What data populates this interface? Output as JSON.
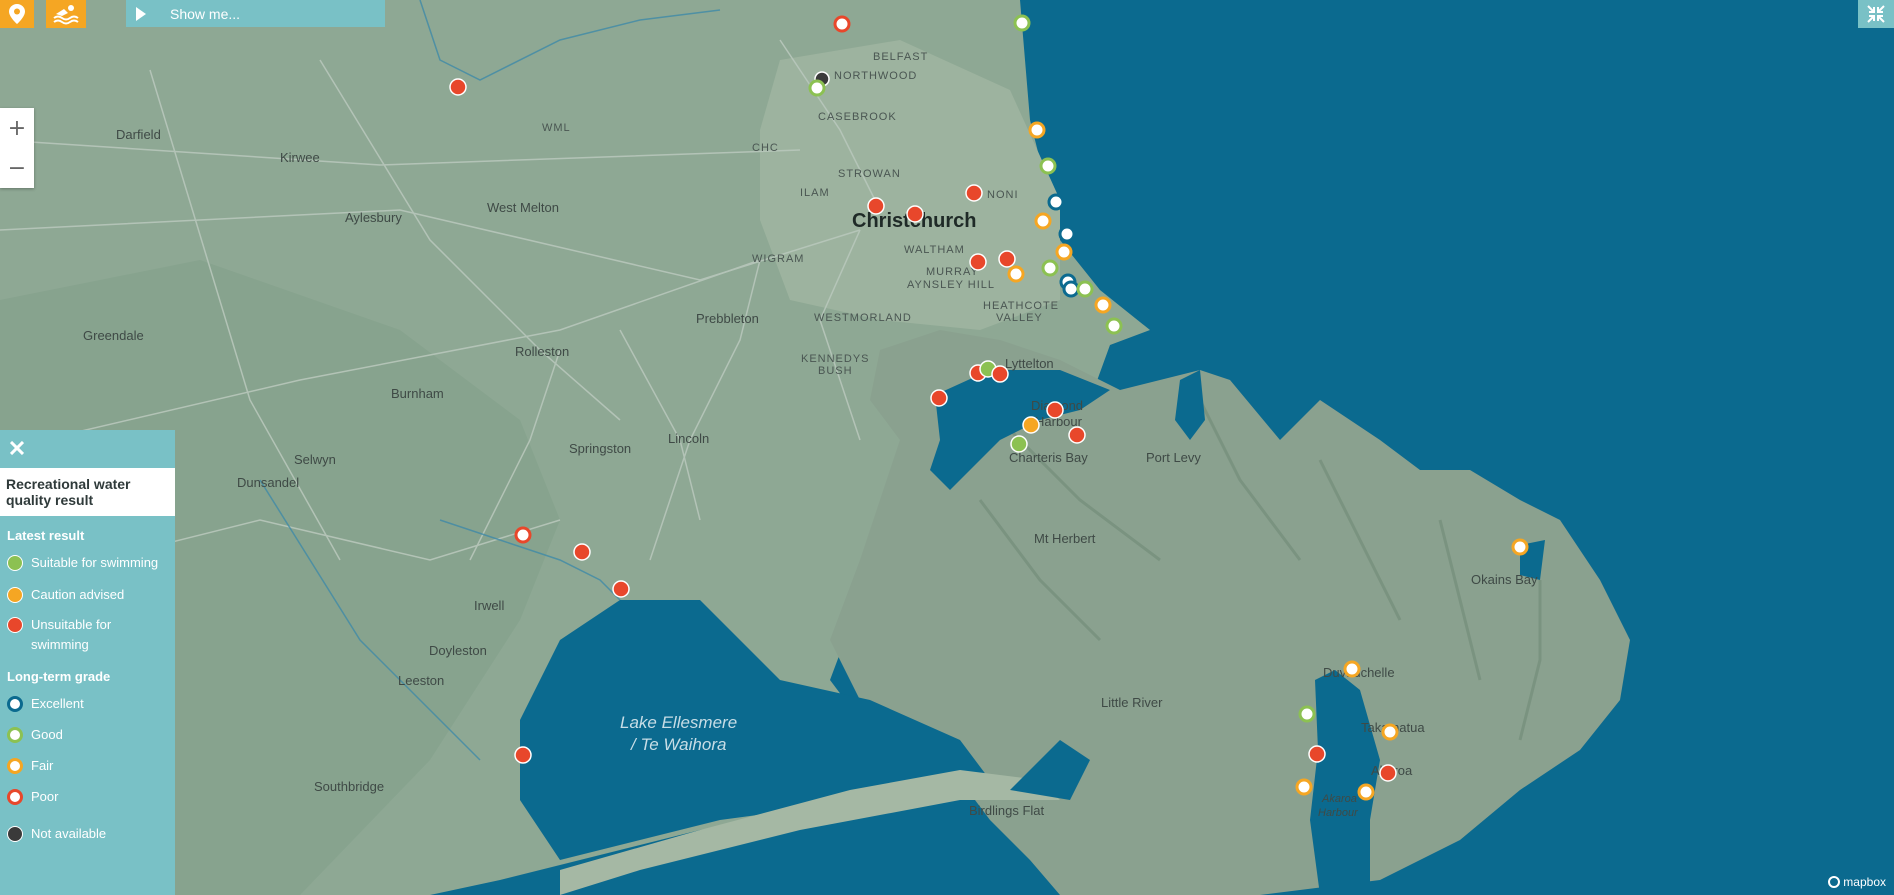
{
  "toolbar": {
    "show_me_label": "Show me...",
    "location_icon": "location-pin-icon",
    "swim_icon": "swimmer-icon",
    "fullscreen_icon": "collapse-icon"
  },
  "zoom": {
    "in_label": "+",
    "out_label": "−"
  },
  "colors": {
    "sea": "#0b6a8f",
    "land": "#8ea894",
    "panel": "#79c1c6",
    "accent": "#f5a623",
    "suitable": "#8cc152",
    "caution": "#f5a623",
    "unsuitable": "#e8472b",
    "excellent": "#0b6a8f",
    "not_available": "#3a3a3a"
  },
  "labels": {
    "darfield": "Darfield",
    "kirwee": "Kirwee",
    "aylesbury": "Aylesbury",
    "west_melton": "West Melton",
    "greendale": "Greendale",
    "rolleston": "Rolleston",
    "burnham": "Burnham",
    "selwyn": "Selwyn",
    "dunsandel": "Dunsandel",
    "prebbleton": "Prebbleton",
    "lincoln": "Lincoln",
    "springston": "Springston",
    "irwell": "Irwell",
    "doyleston": "Doyleston",
    "leeston": "Leeston",
    "southbridge": "Southbridge",
    "christchurch": "Christchurch",
    "belfast": "BELFAST",
    "northwood": "NORTHWOOD",
    "casebrook": "CASEBROOK",
    "strowan": "STROWAN",
    "ilam": "ILAM",
    "wigram": "WIGRAM",
    "waltham": "WALTHAM",
    "murray": "MURRAY",
    "aynsley_hill": "AYNSLEY HILL",
    "westmorland": "WESTMORLAND",
    "heathcote": "HEATHCOTE",
    "valley": "VALLEY",
    "kennedys": "KENNEDYS",
    "bush": "BUSH",
    "noni": "NONI",
    "wml": "WML",
    "chc": "CHC",
    "lyttelton": "Lyttelton",
    "diamond": "Diamond",
    "harbour": "Harbour",
    "charteris_bay": "Charteris Bay",
    "port_levy": "Port Levy",
    "mt_herbert": "Mt Herbert",
    "okains_bay": "Okains Bay",
    "little_river": "Little River",
    "duvauchelle": "Duvauchelle",
    "takamatua": "Takamatua",
    "akaroa": "Akaroa",
    "akaroa_harbour_1": "Akaroa",
    "akaroa_harbour_2": "Harbour",
    "birdlings_flat": "Birdlings Flat",
    "lake_1": "Lake Ellesmere",
    "lake_2": "/ Te Waihora"
  },
  "sites": [
    {
      "name": "site-1",
      "style": "poor"
    },
    {
      "name": "site-2",
      "style": "good"
    },
    {
      "name": "site-3",
      "style": "unsuitable"
    },
    {
      "name": "site-4",
      "style": "na"
    },
    {
      "name": "site-5",
      "style": "good"
    },
    {
      "name": "site-6",
      "style": "fair"
    },
    {
      "name": "site-7",
      "style": "good"
    },
    {
      "name": "site-8",
      "style": "excellent"
    },
    {
      "name": "site-9",
      "style": "unsuitable"
    },
    {
      "name": "site-10",
      "style": "unsuitable"
    },
    {
      "name": "site-11",
      "style": "unsuitable"
    },
    {
      "name": "site-12",
      "style": "fair"
    },
    {
      "name": "site-13",
      "style": "excellent"
    },
    {
      "name": "site-14",
      "style": "fair"
    },
    {
      "name": "site-15",
      "style": "unsuitable"
    },
    {
      "name": "site-16",
      "style": "unsuitable"
    },
    {
      "name": "site-17",
      "style": "good"
    },
    {
      "name": "site-18",
      "style": "fair"
    },
    {
      "name": "site-19",
      "style": "excellent"
    },
    {
      "name": "site-20",
      "style": "excellent"
    },
    {
      "name": "site-21",
      "style": "good"
    },
    {
      "name": "site-22",
      "style": "fair"
    },
    {
      "name": "site-23",
      "style": "good"
    },
    {
      "name": "site-24",
      "style": "unsuitable"
    },
    {
      "name": "site-25",
      "style": "suitable"
    },
    {
      "name": "site-26",
      "style": "unsuitable"
    },
    {
      "name": "site-27",
      "style": "unsuitable"
    },
    {
      "name": "site-28",
      "style": "unsuitable"
    },
    {
      "name": "site-29",
      "style": "caution"
    },
    {
      "name": "site-30",
      "style": "unsuitable"
    },
    {
      "name": "site-31",
      "style": "suitable"
    },
    {
      "name": "site-32",
      "style": "poor"
    },
    {
      "name": "site-33",
      "style": "unsuitable"
    },
    {
      "name": "site-34",
      "style": "unsuitable"
    },
    {
      "name": "site-35",
      "style": "unsuitable"
    },
    {
      "name": "site-36",
      "style": "fair"
    },
    {
      "name": "site-37",
      "style": "fair"
    },
    {
      "name": "site-38",
      "style": "good"
    },
    {
      "name": "site-39",
      "style": "fair"
    },
    {
      "name": "site-40",
      "style": "unsuitable"
    },
    {
      "name": "site-41",
      "style": "unsuitable"
    },
    {
      "name": "site-42",
      "style": "fair"
    },
    {
      "name": "site-43",
      "style": "fair"
    }
  ],
  "legend": {
    "title": "Recreational water quality result",
    "latest_heading": "Latest result",
    "suitable": "Suitable for swimming",
    "caution": "Caution advised",
    "unsuitable": "Unsuitable for swimming",
    "longterm_heading": "Long-term grade",
    "excellent": "Excellent",
    "good": "Good",
    "fair": "Fair",
    "poor": "Poor",
    "not_available": "Not available",
    "close_icon": "close-icon"
  },
  "attribution": {
    "mapbox": "mapbox"
  }
}
